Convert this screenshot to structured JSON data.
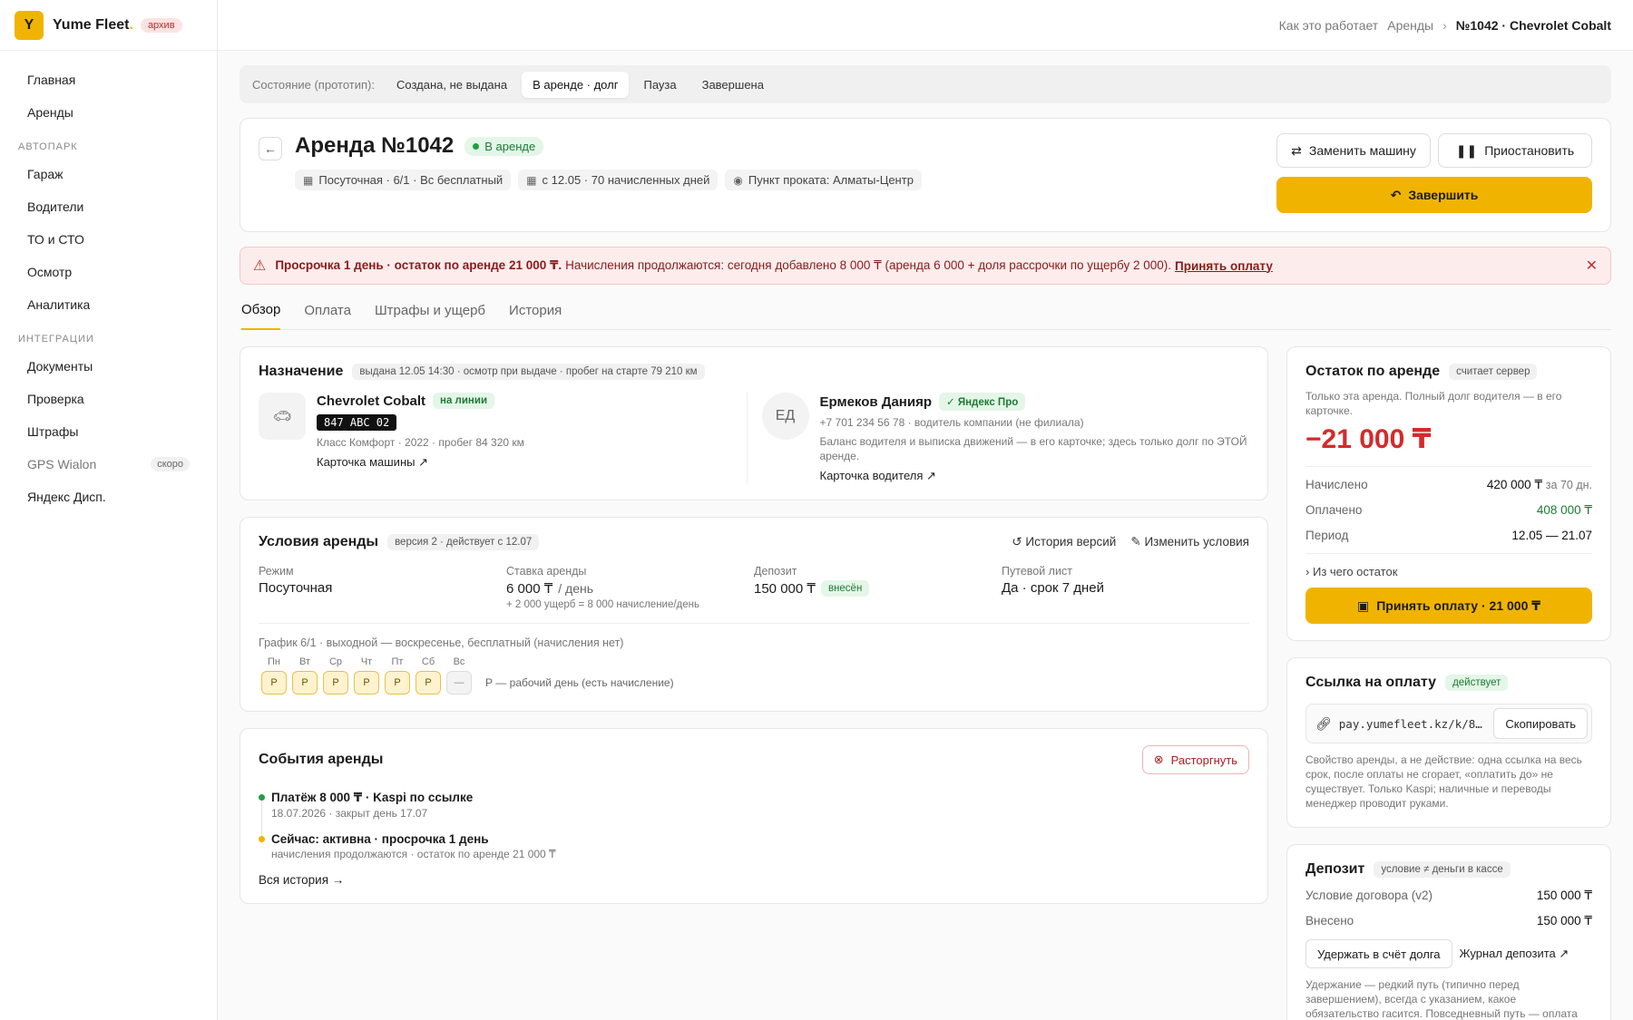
{
  "brand": {
    "logo_letter": "Y",
    "name": "Yume Fleet",
    "dot": ".",
    "badge": "архив"
  },
  "sidebar": {
    "top_items": [
      {
        "label": "Главная"
      },
      {
        "label": "Аренды"
      }
    ],
    "section_fleet": "Автопарк",
    "fleet_items": [
      {
        "label": "Гараж"
      },
      {
        "label": "Водители"
      },
      {
        "label": "ТО и СТО"
      },
      {
        "label": "Осмотр"
      },
      {
        "label": "Аналитика"
      }
    ],
    "section_integrations": "Интеграции",
    "integration_items": [
      {
        "label": "Документы"
      },
      {
        "label": "Проверка"
      },
      {
        "label": "Штрафы"
      },
      {
        "label": "GPS Wialon",
        "badge": "скоро"
      },
      {
        "label": "Яндекс Дисп."
      }
    ]
  },
  "topbar": {
    "how": "Как это работает",
    "rentals": "Аренды",
    "sep": "›",
    "current": "№1042 · Chevrolet Cobalt"
  },
  "state_bar": {
    "label": "Состояние (прототип):",
    "options": [
      "Создана, не выдана",
      "В аренде · долг",
      "Пауза",
      "Завершена"
    ],
    "active": "В аренде · долг"
  },
  "header": {
    "title": "Аренда №1042",
    "status": "В аренде",
    "chips": [
      "Посуточная · 6/1 · Вс бесплатный",
      "с 12.05 · 70 начисленных дней",
      "Пункт проката: Алматы-Центр"
    ],
    "replace_car": "Заменить машину",
    "pause": "Приостановить",
    "finish": "Завершить"
  },
  "alert": {
    "bold": "Просрочка 1 день · остаток по аренде 21 000 ₸.",
    "text": "Начисления продолжаются: сегодня добавлено 8 000 ₸ (аренда 6 000 + доля рассрочки по ущербу 2 000).",
    "link": "Принять оплату",
    "close": "✕"
  },
  "tabs": [
    "Обзор",
    "Оплата",
    "Штрафы и ущерб",
    "История"
  ],
  "assignment": {
    "title": "Назначение",
    "tag": "выдана 12.05 14:30 · осмотр при выдаче · пробег на старте 79 210 км",
    "car": {
      "name": "Chevrolet Cobalt",
      "status": "на линии",
      "plate": "847 ABC 02",
      "meta": "Класс Комфорт · 2022 · пробег 84 320 км",
      "link": "Карточка машины ↗"
    },
    "driver": {
      "initials": "ЕД",
      "name": "Ермеков Данияр",
      "badge": "✓ Яндекс Про",
      "meta": "+7 701 234 56 78 · водитель компании (не филиала)",
      "note": "Баланс водителя и выписка движений — в его карточке; здесь только долг по ЭТОЙ аренде.",
      "link": "Карточка водителя ↗"
    }
  },
  "conditions": {
    "title": "Условия аренды",
    "tag": "версия 2 · действует с 12.07",
    "history": "История версий",
    "edit": "Изменить условия",
    "mode_label": "Режим",
    "mode_value": "Посуточная",
    "rate_label": "Ставка аренды",
    "rate_value": "6 000 ₸",
    "rate_unit": "/ день",
    "rate_note": "+ 2 000 ущерб = 8 000 начисление/день",
    "deposit_label": "Депозит",
    "deposit_value": "150 000 ₸",
    "deposit_badge": "внесён",
    "waybill_label": "Путевой лист",
    "waybill_value": "Да · срок 7 дней",
    "schedule_title": "График 6/1 · выходной — воскресенье, бесплатный (начисления нет)",
    "days": [
      {
        "label": "Пн",
        "mark": "Р"
      },
      {
        "label": "Вт",
        "mark": "Р"
      },
      {
        "label": "Ср",
        "mark": "Р"
      },
      {
        "label": "Чт",
        "mark": "Р"
      },
      {
        "label": "Пт",
        "mark": "Р"
      },
      {
        "label": "Сб",
        "mark": "Р"
      },
      {
        "label": "Вс",
        "mark": "—"
      }
    ],
    "legend": "Р — рабочий день (есть начисление)"
  },
  "events": {
    "title": "События аренды",
    "terminate": "Расторгнуть",
    "items": [
      {
        "title": "Платёж 8 000 ₸ · Kaspi по ссылке",
        "sub": "18.07.2026 · закрыт день 17.07",
        "color": "#22a046"
      },
      {
        "title": "Сейчас: активна · просрочка 1 день",
        "sub": "начисления продолжаются · остаток по аренде 21 000 ₸",
        "color": "#f0b400"
      }
    ],
    "all": "Вся история →"
  },
  "balance": {
    "title": "Остаток по аренде",
    "tag": "считает сервер",
    "note": "Только эта аренда. Полный долг водителя — в его карточке.",
    "amount": "−21 000 ₸",
    "accrued_label": "Начислено",
    "accrued_value": "420 000 ₸",
    "accrued_suffix": "за 70 дн.",
    "paid_label": "Оплачено",
    "paid_value": "408 000 ₸",
    "period_label": "Период",
    "period_value": "12.05 — 21.07",
    "expand": "Из чего остаток",
    "pay_button": "Принять оплату · 21 000 ₸"
  },
  "paylink": {
    "title": "Ссылка на оплату",
    "status": "действует",
    "url": "pay.yumefleet.kz/k/8f…",
    "copy": "Скопировать",
    "note": "Свойство аренды, а не действие: одна ссылка на весь срок, после оплаты не сгорает, «оплатить до» не существует. Только Kaspi; наличные и переводы менеджер проводит руками."
  },
  "deposit": {
    "title": "Депозит",
    "tag": "условие ≠ деньги в кассе",
    "contract_label": "Условие договора (v2)",
    "contract_value": "150 000 ₸",
    "paid_label": "Внесено",
    "paid_value": "150 000 ₸",
    "hold": "Удержать в счёт долга",
    "journal": "Журнал депозита ↗",
    "note": "Удержание — редкий путь (типично перед завершением), всегда с указанием, какое обязательство гасится. Повседневный путь — оплата"
  }
}
